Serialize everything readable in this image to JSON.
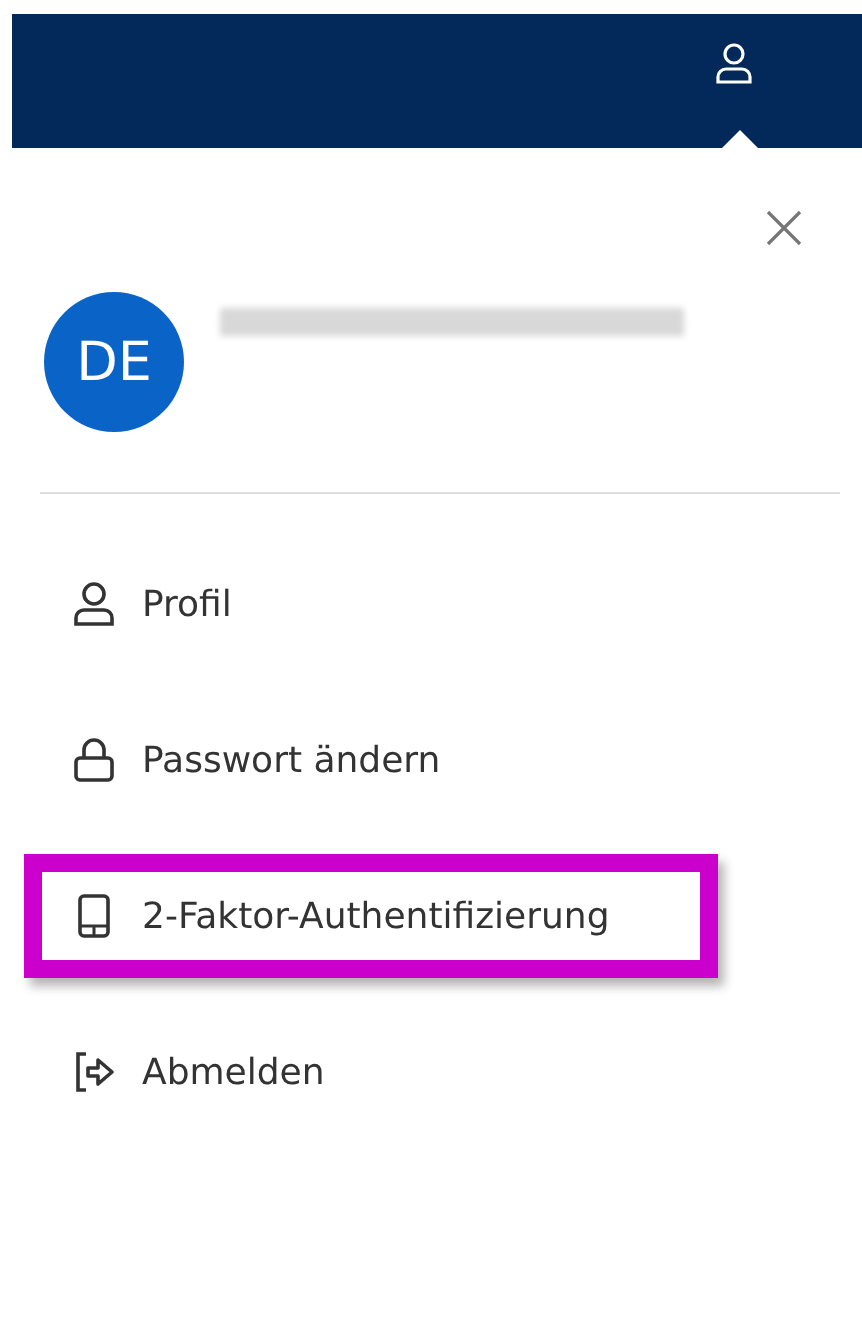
{
  "header": {
    "menu_open": true
  },
  "user": {
    "initials": "DE",
    "name_redacted": true
  },
  "menu_items": [
    {
      "kind": "user",
      "label": "Profil",
      "highlighted": false
    },
    {
      "kind": "lock",
      "label": "Passwort ändern",
      "highlighted": false
    },
    {
      "kind": "phone",
      "label": "2-Faktor-Authentifizierung",
      "highlighted": true
    },
    {
      "kind": "logout",
      "label": "Abmelden",
      "highlighted": false
    }
  ]
}
